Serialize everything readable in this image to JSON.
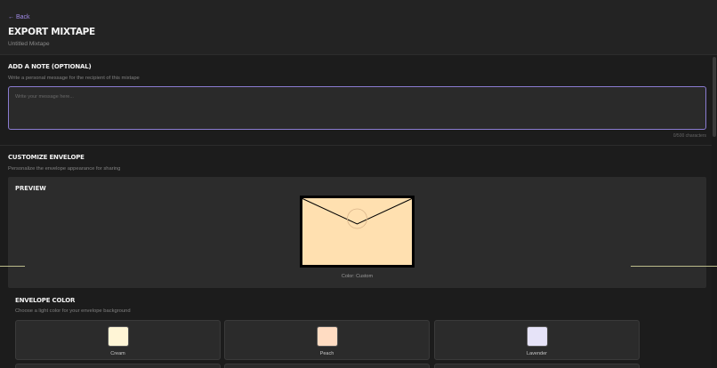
{
  "header": {
    "back_label": "← Back",
    "title": "EXPORT MIXTAPE",
    "subtitle": "Untitled Mixtape"
  },
  "note": {
    "title": "ADD A NOTE (OPTIONAL)",
    "description": "Write a personal message for the recipient of this mixtape",
    "placeholder": "Write your message here...",
    "char_count": "0/500 characters"
  },
  "customize": {
    "title": "CUSTOMIZE ENVELOPE",
    "description": "Personalize the envelope appearance for sharing",
    "preview_label": "PREVIEW",
    "color_label": "Color: Custom",
    "envelope_color_hex": "#ffe0b0"
  },
  "envelope_color": {
    "title": "ENVELOPE COLOR",
    "description": "Choose a light color for your envelope background",
    "options": [
      {
        "label": "Cream",
        "color": "#fff5d6"
      },
      {
        "label": "Peach",
        "color": "#ffdcc2"
      },
      {
        "label": "Lavender",
        "color": "#e6e3f8"
      }
    ]
  },
  "colors": {
    "accent": "#a08ae6",
    "background": "#1c1c1c"
  }
}
